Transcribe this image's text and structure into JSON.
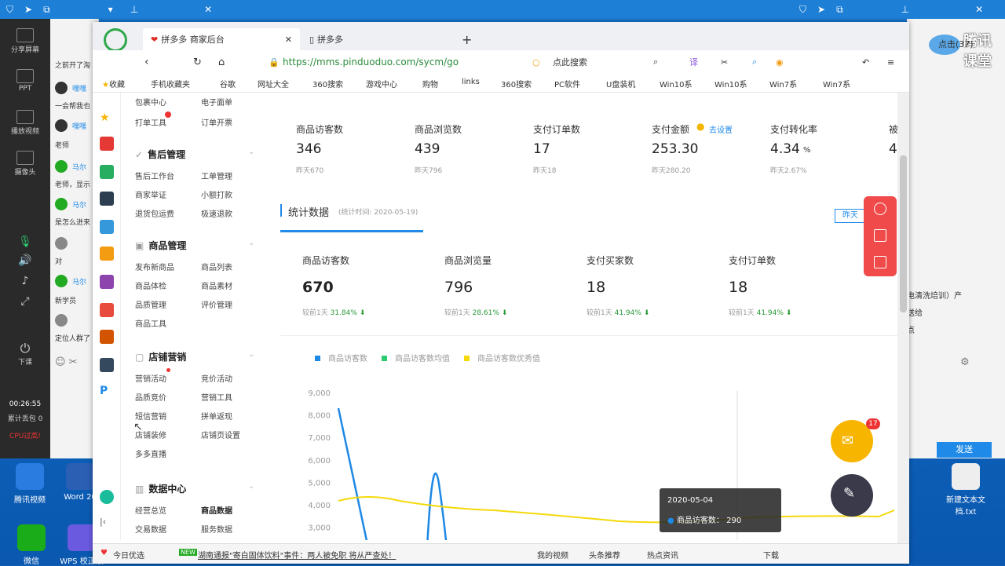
{
  "window_bar": {
    "label": "腾讯课堂",
    "right_text": "点击(37)"
  },
  "left_strip": {
    "items": [
      "分享屏幕",
      "PPT",
      "播放视频",
      "摄像头",
      "下课"
    ],
    "timer": "00:26:55",
    "stats": "累计丢包 0",
    "cpu": "CPU过高!"
  },
  "chat": {
    "lines": [
      "之前开了淘",
      "一会帮我也",
      "老师",
      "老师，显示",
      "是怎么进来",
      "对",
      "新学员",
      "定位人群了"
    ],
    "names": [
      "嘿嘿",
      "嘿嘿",
      "马尔",
      "马尔",
      "马尔"
    ]
  },
  "browser": {
    "tabs": [
      {
        "label": "拼多多 商家后台",
        "active": true
      },
      {
        "label": "拼多多",
        "active": false
      }
    ],
    "url": "https://mms.pinduoduo.com/sycm/go",
    "search_placeholder": "点此搜索",
    "bookmarks": [
      "收藏",
      "手机收藏夹",
      "谷歌",
      "网址大全",
      "360搜索",
      "游戏中心",
      "购物",
      "links",
      "360搜索",
      "PC软件",
      "U盘装机",
      "Win10系",
      "Win10系",
      "Win7系",
      "Win7系"
    ]
  },
  "sidenav": {
    "top_items": [
      "包裹中心",
      "电子面单",
      "打单工具",
      "订单开票"
    ],
    "sections": [
      {
        "title": "售后管理",
        "items": [
          "售后工作台",
          "工单管理",
          "商家举证",
          "小额打款",
          "退货包运费",
          "极速退款"
        ]
      },
      {
        "title": "商品管理",
        "items": [
          "发布新商品",
          "商品列表",
          "商品体检",
          "商品素材",
          "品质管理",
          "评价管理",
          "商品工具"
        ]
      },
      {
        "title": "店铺营销",
        "items": [
          "营销活动",
          "竞价活动",
          "品质竞价",
          "营销工具",
          "短信营销",
          "拼单返现",
          "店铺装修",
          "店铺页设置",
          "多多直播"
        ]
      },
      {
        "title": "数据中心",
        "items": [
          "经营总览",
          "商品数据",
          "交易数据",
          "服务数据"
        ]
      }
    ]
  },
  "top_stats": [
    {
      "label": "商品访客数",
      "value": "346",
      "sub": "昨天670"
    },
    {
      "label": "商品浏览数",
      "value": "439",
      "sub": "昨天796"
    },
    {
      "label": "支付订单数",
      "value": "17",
      "sub": "昨天18"
    },
    {
      "label": "支付金额",
      "value": "253.30",
      "sub": "昨天280.20",
      "link": "去设置"
    },
    {
      "label": "支付转化率",
      "value": "4.34",
      "unit": "%",
      "sub": "昨天2.67%"
    }
  ],
  "section": {
    "title": "统计数据",
    "time": "(统计时间: 2020-05-19)",
    "range_btn": "昨天"
  },
  "cards": [
    {
      "label": "商品访客数",
      "value": "670",
      "compare": "较前1天",
      "pct": "31.84%"
    },
    {
      "label": "商品浏览量",
      "value": "796",
      "compare": "较前1天",
      "pct": "28.61%"
    },
    {
      "label": "支付买家数",
      "value": "18",
      "compare": "较前1天",
      "pct": "41.94%"
    },
    {
      "label": "支付订单数",
      "value": "18",
      "compare": "较前1天",
      "pct": "41.94%"
    }
  ],
  "chart_data": {
    "type": "line",
    "series": [
      {
        "name": "商品访客数",
        "color": "#1e88e5"
      },
      {
        "name": "商品访客数均值",
        "color": "#2ecc71"
      },
      {
        "name": "商品访客数优秀值",
        "color": "#f5d90a"
      }
    ],
    "yticks": [
      "9,000",
      "8,000",
      "7,000",
      "6,000",
      "5,000",
      "4,000",
      "3,000"
    ],
    "ylim": [
      3000,
      9000
    ],
    "tooltip": {
      "date": "2020-05-04",
      "label": "商品访客数",
      "value": "290"
    }
  },
  "floating": {
    "mail_badge": "17"
  },
  "right_panel": {
    "send": "发送",
    "lines": [
      "电清洗培训）产",
      "送给",
      "点"
    ]
  },
  "statusbar": [
    "今日优选",
    "NEW",
    "湖南通报\"寄白固体饮料\"事件：两人被免职 将从严查处！",
    "我的视频",
    "头条推荐",
    "热点资讯",
    "下载"
  ],
  "desktop_icons": [
    "腾讯视频",
    "Word 20",
    "微信",
    "WPS 校正版",
    "新建文本文档.txt"
  ]
}
